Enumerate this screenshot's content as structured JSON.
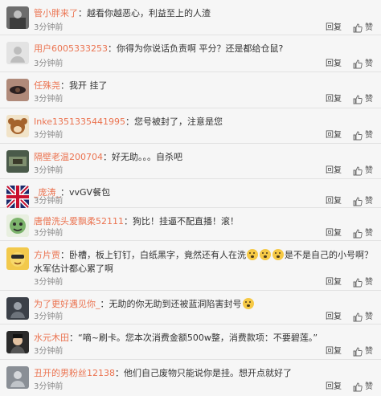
{
  "comments": [
    {
      "user": "管小胖来了",
      "text": "越看你越恶心，利益至上的人渣",
      "time": "3分钟前",
      "reply": "回复"
    },
    {
      "user": "用户6005333253",
      "text": "你得为你说话负责啊  平分？还是都给仓鼠?",
      "time": "3分钟前",
      "reply": "回复"
    },
    {
      "user": "任殊尧",
      "text": "我开 挂了",
      "time": "3分钟前",
      "reply": "回复"
    },
    {
      "user": "Inke1351335441995",
      "text": "您号被封了，注意是您",
      "time": "3分钟前",
      "reply": "回复"
    },
    {
      "user": "隔壁老温200704",
      "text": "好无助。。。自杀吧",
      "time": "3分钟前",
      "reply": "回复"
    },
    {
      "user": "_庞涛_",
      "text": "vvGV餐包",
      "time": "3分钟前",
      "reply": "回复"
    },
    {
      "user": "唐僧洗头爱飘柔52111",
      "text": "狗比！挂逼不配直播！滚！",
      "time": "3分钟前",
      "reply": "回复"
    },
    {
      "user": "方片贾",
      "text": "卧槽，板上钉钉，白纸黑字，竟然还有人在洗",
      "text_after": "是不是自己的小号啊？水军估计都心累了啊",
      "time": "3分钟前",
      "reply": "回复"
    },
    {
      "user": "为了更好遇见你_",
      "text": "无助的你无助到还被蓝洞陷害封号",
      "time": "3分钟前",
      "reply": "回复"
    },
    {
      "user": "水元木田",
      "text": "“嘀~刷卡。您本次消费金额500w整，消费款项：不要碧莲。”",
      "time": "3分钟前",
      "reply": "回复"
    },
    {
      "user": "丑开的男粉丝12138",
      "text": "他们自己废物只能说你是挂。想开点就好了",
      "time": "3分钟前",
      "reply": "回复"
    }
  ],
  "colors": {
    "username": "#eb7350",
    "text": "#333333",
    "time": "#888888"
  },
  "icons": {
    "like": "thumbs-up-icon",
    "emoji": "scared-face-emoji"
  }
}
